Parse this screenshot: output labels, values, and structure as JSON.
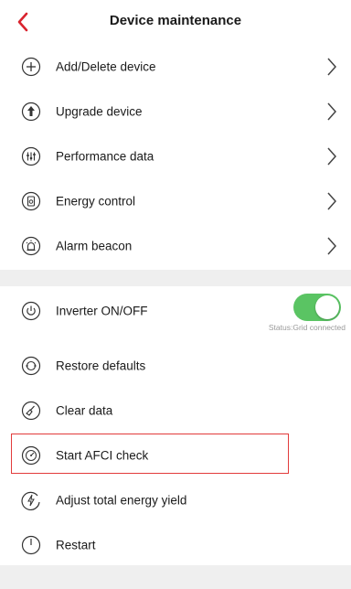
{
  "header": {
    "title": "Device maintenance",
    "back_icon": "chevron-left-icon",
    "accent_color": "#d9232e"
  },
  "group1": {
    "items": [
      {
        "label": "Add/Delete device",
        "icon": "plus-circle-icon"
      },
      {
        "label": "Upgrade device",
        "icon": "upgrade-arrow-icon"
      },
      {
        "label": "Performance data",
        "icon": "sliders-icon"
      },
      {
        "label": "Energy control",
        "icon": "energy-control-icon"
      },
      {
        "label": "Alarm beacon",
        "icon": "alarm-beacon-icon"
      }
    ]
  },
  "group2": {
    "inverter": {
      "label": "Inverter ON/OFF",
      "icon": "power-icon",
      "toggle_on": true,
      "toggle_color": "#5ac463",
      "status": "Status:Grid connected"
    },
    "items": [
      {
        "label": "Restore defaults",
        "icon": "restore-icon"
      },
      {
        "label": "Clear data",
        "icon": "clear-data-icon"
      },
      {
        "label": "Start AFCI check",
        "icon": "afci-check-icon",
        "highlighted": true
      },
      {
        "label": "Adjust total energy yield",
        "icon": "energy-yield-icon"
      },
      {
        "label": "Restart",
        "icon": "restart-icon"
      }
    ]
  },
  "highlight_color": "#e23b3b"
}
